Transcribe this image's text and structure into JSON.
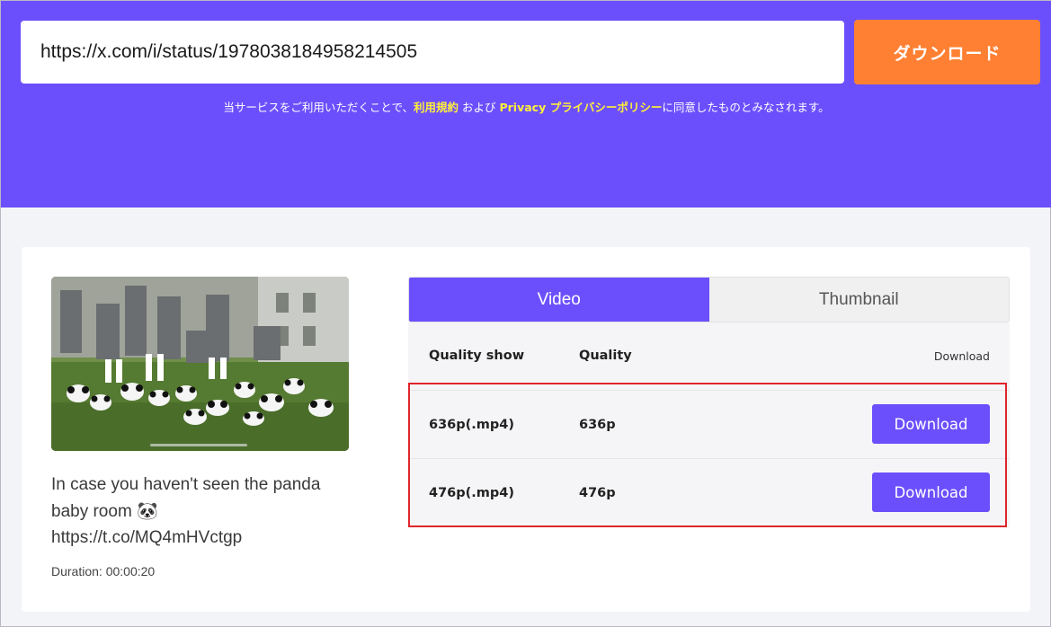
{
  "header": {
    "url_value": "https://x.com/i/status/1978038184958214505",
    "download_label": "ダウンロード",
    "terms_prefix": "当サービスをご利用いただくことで、",
    "terms_link": "利用規約",
    "terms_mid": " および ",
    "privacy_link": "Privacy プライバシーポリシー",
    "terms_suffix": "に同意したものとみなされます。"
  },
  "media": {
    "tweet_text": "In case you haven't seen the panda baby room 🐼 https://t.co/MQ4mHVctgp",
    "duration": "Duration: 00:00:20"
  },
  "tabs": [
    {
      "label": "Video",
      "active": true
    },
    {
      "label": "Thumbnail",
      "active": false
    }
  ],
  "table": {
    "headers": {
      "quality_show": "Quality show",
      "quality": "Quality",
      "download": "Download"
    },
    "rows": [
      {
        "quality_show": "636p(.mp4)",
        "quality": "636p",
        "button": "Download"
      },
      {
        "quality_show": "476p(.mp4)",
        "quality": "476p",
        "button": "Download"
      }
    ]
  },
  "colors": {
    "brand_purple": "#6c4ffc",
    "download_orange": "#ff8033",
    "link_yellow": "#ffef3a",
    "highlight_red": "#e0242b"
  }
}
